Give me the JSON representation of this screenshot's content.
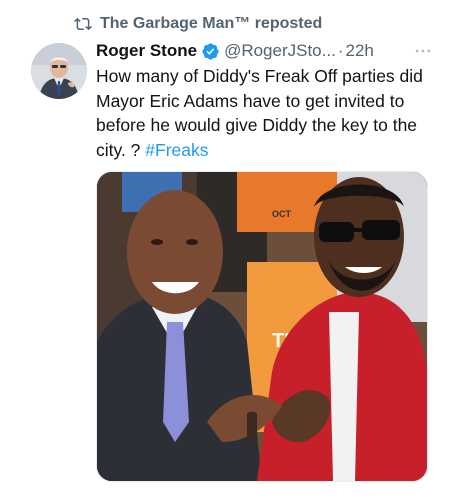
{
  "repost": {
    "icon": "repost-icon",
    "text": "The Garbage Man™ reposted"
  },
  "tweet": {
    "author_name": "Roger Stone",
    "verified_icon": "verified-badge-icon",
    "handle": "@RogerJSto...",
    "separator": "·",
    "time": "22h",
    "more_icon": "more-options-icon",
    "text_main": "How many of Diddy's Freak Off parties did Mayor Eric Adams have to get invited to before he would give Diddy the key to the city. ? ",
    "hashtag": "#Freaks",
    "media": {
      "sign_text_1": "OCT",
      "sign_text_2": "TICK"
    }
  },
  "colors": {
    "secondary_text": "#536471",
    "link": "#1d9bf0",
    "verified_blue": "#1d9bf0"
  }
}
